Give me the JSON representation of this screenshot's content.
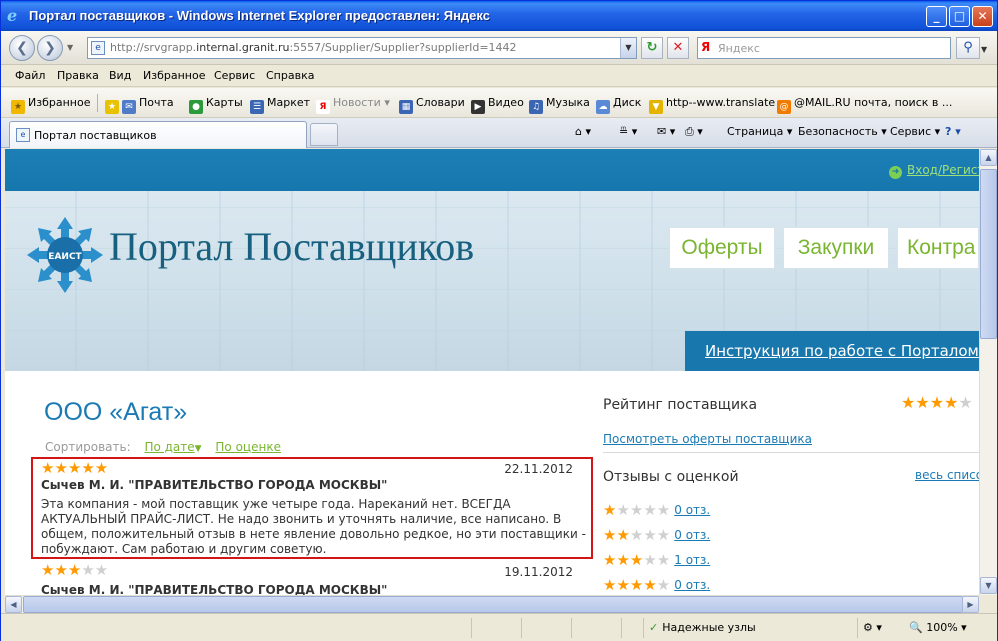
{
  "window": {
    "title": "Портал поставщиков - Windows Internet Explorer предоставлен: Яндекс",
    "min": "_",
    "max": "□",
    "close": "✕"
  },
  "address": {
    "url_prefix": "http://srvgrapp.",
    "url_host": "internal.granit.ru",
    "url_suffix": ":5557/Supplier/Supplier?supplierId=1442",
    "search_placeholder": "Яндекс",
    "search_logo": "Я"
  },
  "menu": [
    "Файл",
    "Правка",
    "Вид",
    "Избранное",
    "Сервис",
    "Справка"
  ],
  "favorites": {
    "label": "Избранное",
    "items": [
      "Почта",
      "Карты",
      "Маркет",
      "Новости",
      "Словари",
      "Видео",
      "Музыка",
      "Диск",
      "http--www.translate",
      "@MAIL.RU почта, поиск в ..."
    ]
  },
  "tab": {
    "label": "Портал поставщиков"
  },
  "commands": [
    "Страница",
    "Безопасность",
    "Сервис"
  ],
  "page": {
    "login": "Вход/Регист",
    "brand": "Портал Поставщиков",
    "logo_text": "ЕАИСТ",
    "nav": [
      "Оферты",
      "Закупки",
      "Контра"
    ],
    "instructions": "Инструкция по работе с Порталом",
    "company": "ООО «Агат»",
    "sort_label": "Сортировать:",
    "sort_date": "По дате",
    "sort_rating": "По оценке",
    "reviews": [
      {
        "rating": 5,
        "date": "22.11.2012",
        "author": "Сычев М. И. \"ПРАВИТЕЛЬСТВО ГОРОДА МОСКВЫ\"",
        "text": "Эта компания - мой поставщик уже четыре года. Нареканий нет. ВСЕГДА АКТУАЛЬНЫЙ ПРАЙС-ЛИСТ. Не надо звонить и уточнять наличие, все написано. В общем, положительный отзыв в нете явление довольно редкое, но эти поставщики - побуждают. Сам работаю и другим советую."
      },
      {
        "rating": 3,
        "date": "19.11.2012",
        "author": "Сычев М. И. \"ПРАВИТЕЛЬСТВО ГОРОДА МОСКВЫ\""
      }
    ],
    "rating_title": "Рейтинг поставщика",
    "supplier_rating": 4,
    "offers_link": "Посмотреть оферты поставщика",
    "reviews_title": "Отзывы с оценкой",
    "all_link": "весь списо",
    "rating_rows": [
      {
        "stars": 1,
        "count": "0 отз."
      },
      {
        "stars": 2,
        "count": "0 отз."
      },
      {
        "stars": 3,
        "count": "1 отз."
      },
      {
        "stars": 4,
        "count": "0 отз."
      }
    ]
  },
  "status": {
    "zone": "Надежные узлы",
    "zoom": "100%"
  },
  "colors": {
    "accent": "#1a7ab3",
    "green": "#7ab531",
    "star": "#ff9a00",
    "highlight": "#d41515"
  }
}
